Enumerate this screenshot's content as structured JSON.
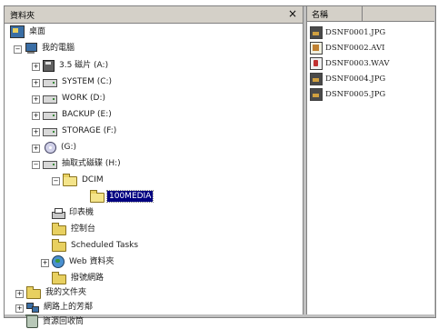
{
  "window": {
    "pane_title": "資料夾"
  },
  "tree": [
    {
      "id": "desktop",
      "label": "桌面",
      "icon": "desktop-icon",
      "expander": ""
    },
    {
      "id": "my-computer",
      "label": "我的電腦",
      "icon": "computer-icon",
      "expander": "−"
    },
    {
      "id": "floppy",
      "label": "3.5 磁片 (A:)",
      "icon": "floppy-icon",
      "expander": "+"
    },
    {
      "id": "drive-c",
      "label": "SYSTEM (C:)",
      "icon": "drive-icon",
      "expander": "+"
    },
    {
      "id": "drive-d",
      "label": "WORK (D:)",
      "icon": "drive-icon",
      "expander": "+"
    },
    {
      "id": "drive-e",
      "label": "BACKUP (E:)",
      "icon": "drive-icon",
      "expander": "+"
    },
    {
      "id": "drive-f",
      "label": "STORAGE (F:)",
      "icon": "drive-icon",
      "expander": "+"
    },
    {
      "id": "drive-g",
      "label": "(G:)",
      "icon": "cd-icon",
      "expander": "+"
    },
    {
      "id": "removable",
      "label": "抽取式磁碟 (H:)",
      "icon": "drive-icon",
      "expander": "−"
    },
    {
      "id": "dcim",
      "label": "DCIM",
      "icon": "folder-open-icon",
      "expander": "−"
    },
    {
      "id": "100media",
      "label": "100MEDIA",
      "icon": "folder-open-icon",
      "expander": "",
      "selected": true
    },
    {
      "id": "printers",
      "label": "印表機",
      "icon": "printer-folder-icon",
      "expander": ""
    },
    {
      "id": "control-panel",
      "label": "控制台",
      "icon": "control-panel-folder-icon",
      "expander": ""
    },
    {
      "id": "scheduled-tasks",
      "label": "Scheduled Tasks",
      "icon": "folder-icon",
      "expander": ""
    },
    {
      "id": "web-folders",
      "label": "Web 資料夾",
      "icon": "globe-icon",
      "expander": "+"
    },
    {
      "id": "dialup",
      "label": "撥號網路",
      "icon": "network-folder-icon",
      "expander": ""
    },
    {
      "id": "my-documents",
      "label": "我的文件夾",
      "icon": "folder-icon",
      "expander": "+"
    },
    {
      "id": "network-neighborhood",
      "label": "網路上的芳鄰",
      "icon": "network-icon",
      "expander": "+"
    },
    {
      "id": "recycle-bin",
      "label": "資源回收筒",
      "icon": "recycle-bin-icon",
      "expander": ""
    }
  ],
  "file_list": {
    "column_name": "名稱",
    "files": [
      {
        "name": "DSNF0001.JPG",
        "icon": "jpg-file-icon"
      },
      {
        "name": "DSNF0002.AVI",
        "icon": "avi-file-icon"
      },
      {
        "name": "DSNF0003.WAV",
        "icon": "wav-file-icon"
      },
      {
        "name": "DSNF0004.JPG",
        "icon": "jpg-file-icon"
      },
      {
        "name": "DSNF0005.JPG",
        "icon": "jpg-file-icon"
      }
    ]
  }
}
